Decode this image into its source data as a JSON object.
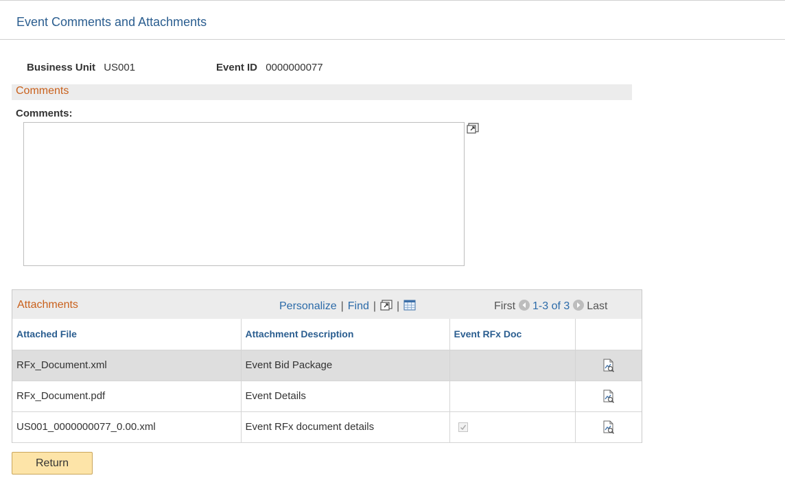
{
  "page": {
    "title": "Event Comments and Attachments"
  },
  "keys": {
    "business_unit_label": "Business Unit",
    "business_unit_value": "US001",
    "event_id_label": "Event ID",
    "event_id_value": "0000000077"
  },
  "comments": {
    "section_title": "Comments",
    "label": "Comments:",
    "value": ""
  },
  "attachments": {
    "title": "Attachments",
    "personalize": "Personalize",
    "find": "Find",
    "first": "First",
    "range": "1-3 of 3",
    "last": "Last",
    "columns": [
      "Attached File",
      "Attachment Description",
      "Event RFx Doc",
      ""
    ],
    "rows": [
      {
        "file": "RFx_Document.xml",
        "description": "Event Bid Package",
        "rfx_doc": false,
        "selected": true
      },
      {
        "file": "RFx_Document.pdf",
        "description": "Event Details",
        "rfx_doc": false,
        "selected": false
      },
      {
        "file": "US001_0000000077_0.00.xml",
        "description": "Event RFx document details",
        "rfx_doc": true,
        "selected": false
      }
    ]
  },
  "buttons": {
    "return": "Return"
  },
  "colors": {
    "title_blue": "#2a5d8f",
    "section_orange": "#c9601b",
    "link_blue": "#2b6aa8",
    "button_bg": "#fde4a8"
  }
}
